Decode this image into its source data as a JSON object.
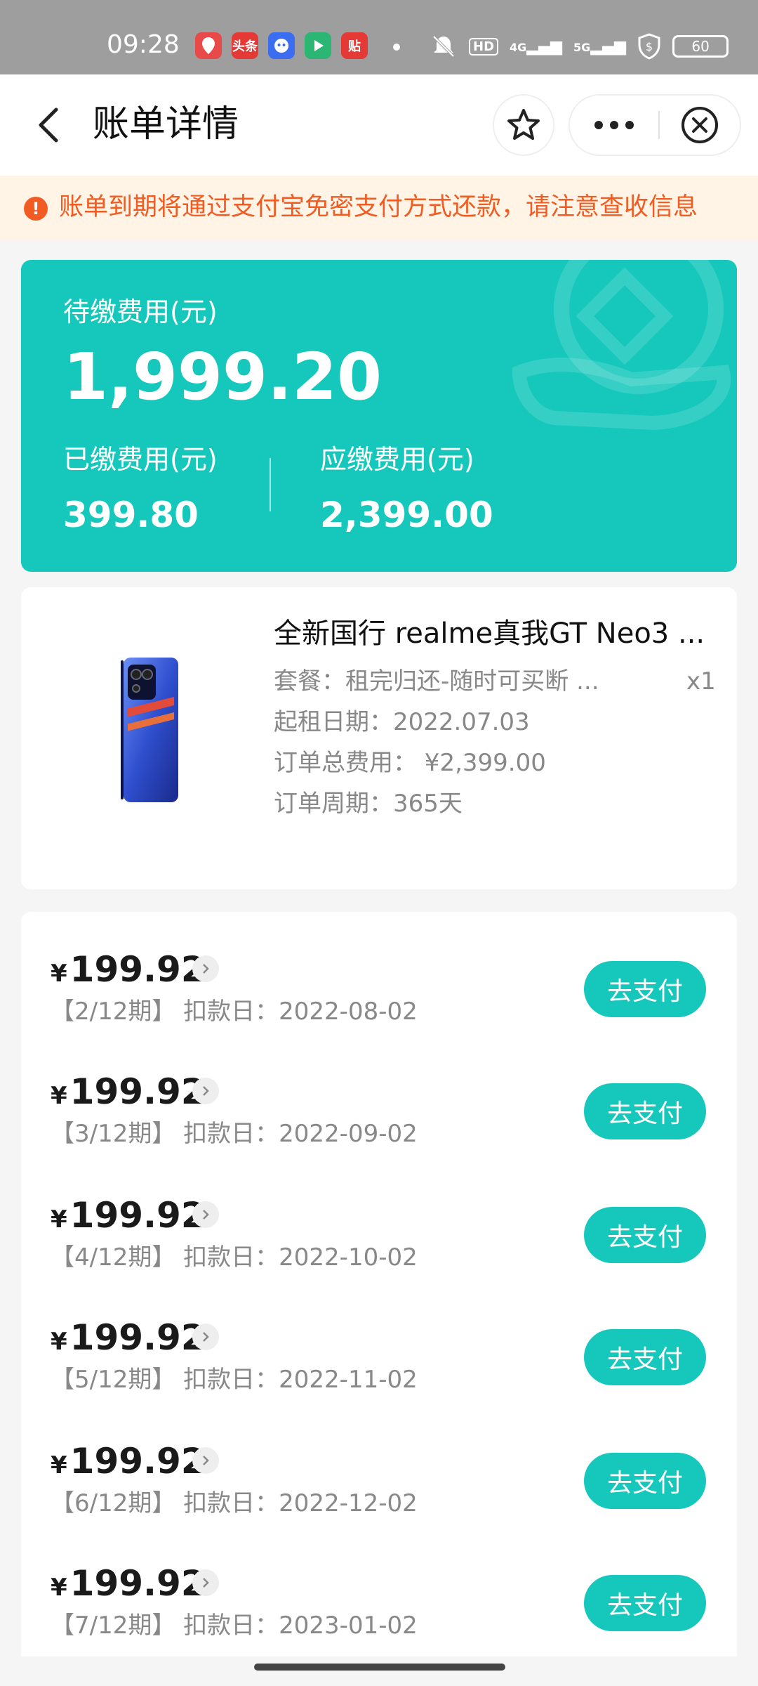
{
  "status_bar": {
    "time": "09:28",
    "apps": [
      {
        "icon": "map-app-icon",
        "text": "",
        "color": "#e84a4a"
      },
      {
        "icon": "toutiao-app-icon",
        "text": "头条",
        "color": "#e53935"
      },
      {
        "icon": "qq-app-icon",
        "text": "",
        "color": "#3a6df0"
      },
      {
        "icon": "video-app-icon",
        "text": "",
        "color": "#2bb673"
      },
      {
        "icon": "jd-app-icon",
        "text": "贴",
        "color": "#e53935"
      }
    ],
    "hd_label": "HD",
    "net_4g": "4G",
    "net_5g": "5G",
    "battery": "60"
  },
  "nav": {
    "title": "账单详情"
  },
  "notice": {
    "text": "账单到期将通过支付宝免密支付方式还款，请注意查收信息"
  },
  "summary": {
    "due_label": "待缴费用(元)",
    "due_amount": "1,999.20",
    "paid_label": "已缴费用(元)",
    "paid_amount": "399.80",
    "total_label": "应缴费用(元)",
    "total_amount": "2,399.00"
  },
  "product": {
    "title": "全新国行 realme真我GT Neo3 ...",
    "plan": "套餐：租完归还-随时可买断 ...",
    "quantity": "x1",
    "start_date": "起租日期：2022.07.03",
    "total_cost": "订单总费用： ¥2,399.00",
    "period": "订单周期：365天"
  },
  "bills": [
    {
      "currency": "¥",
      "amount": "199.92",
      "sub": "【2/12期】 扣款日：2022-08-02",
      "button": "去支付"
    },
    {
      "currency": "¥",
      "amount": "199.92",
      "sub": "【3/12期】 扣款日：2022-09-02",
      "button": "去支付"
    },
    {
      "currency": "¥",
      "amount": "199.92",
      "sub": "【4/12期】 扣款日：2022-10-02",
      "button": "去支付"
    },
    {
      "currency": "¥",
      "amount": "199.92",
      "sub": "【5/12期】 扣款日：2022-11-02",
      "button": "去支付"
    },
    {
      "currency": "¥",
      "amount": "199.92",
      "sub": "【6/12期】 扣款日：2022-12-02",
      "button": "去支付"
    },
    {
      "currency": "¥",
      "amount": "199.92",
      "sub": "【7/12期】 扣款日：2023-01-02",
      "button": "去支付"
    }
  ],
  "colors": {
    "accent": "#16c8bc",
    "warning": "#f25b21",
    "notice_bg": "#fff4e5"
  }
}
